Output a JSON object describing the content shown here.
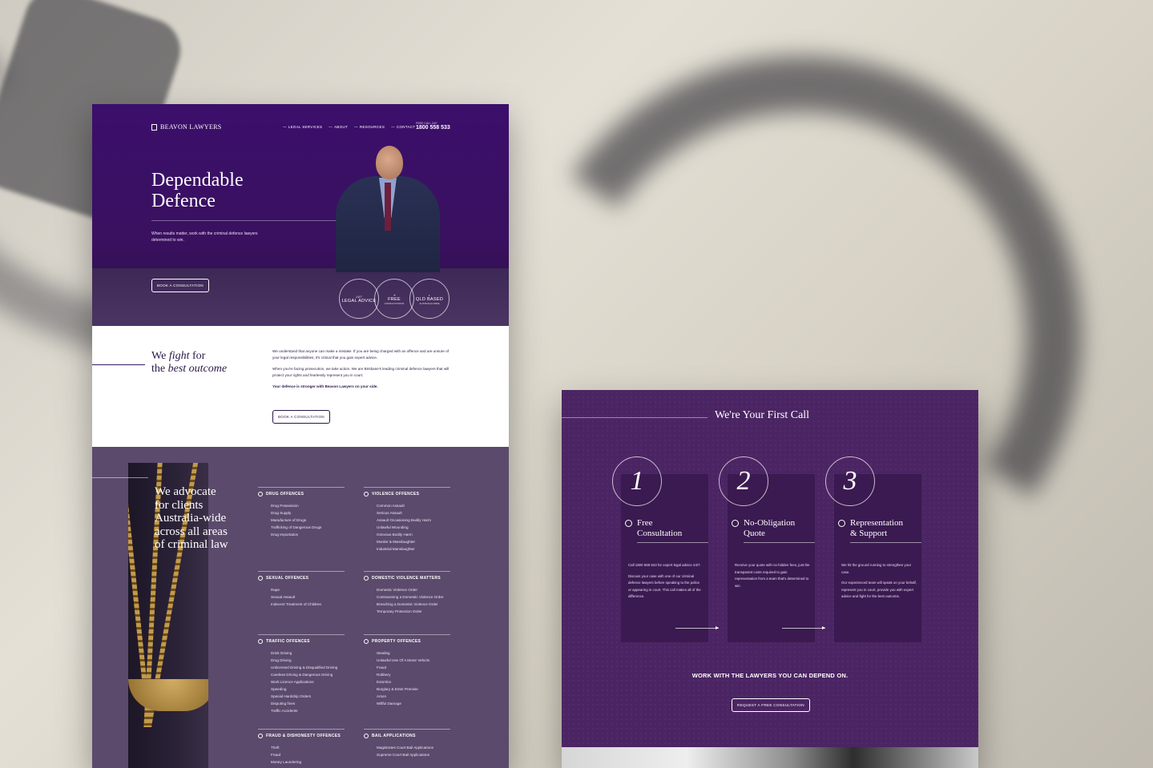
{
  "site": {
    "brand": "BEAVON LAWYERS",
    "nav": [
      "LEGAL SERVICES",
      "ABOUT",
      "RESOURCES",
      "CONTACT"
    ],
    "phone_label": "FREE CALL 24/7",
    "phone": "1800 558 533"
  },
  "hero": {
    "title_line1": "Dependable",
    "title_line2": "Defence",
    "subtitle": "When results matter, work with the criminal defence lawyers determined to win.",
    "cta": "BOOK A CONSULTATION",
    "badges": [
      {
        "top": "24/7",
        "main": "LEGAL ADVICE",
        "sub": ""
      },
      {
        "top": "",
        "main": "FREE",
        "sub": "CONSULTATIONS"
      },
      {
        "top": "",
        "main": "QLD BASED",
        "sub": "AUSTRALIA WIDE"
      }
    ]
  },
  "intro": {
    "title_a": "We",
    "title_b": "fight",
    "title_c": "for",
    "title_d": "the",
    "title_e": "best outcome",
    "para1": "We understand that anyone can make a mistake. If you are being charged with an offence and are unsure of your legal responsibilities, it's critical that you gain expert advice.",
    "para2": "When you're facing prosecution, we take action. We are Brisbane's leading criminal defence lawyers that will protect your rights and fearlessly represent you in court.",
    "para3": "Your defence is stronger with Beavon Lawyers on your side.",
    "cta": "BOOK A CONSULTATION"
  },
  "practice": {
    "title_lines": [
      "We advocate",
      "for clients",
      "Australia-wide",
      "across all areas",
      "of criminal law"
    ],
    "categories": [
      {
        "name": "DRUG OFFENCES",
        "items": [
          "Drug Possession",
          "Drug Supply",
          "Manufacture of Drugs",
          "Trafficking of Dangerous Drugs",
          "Drug Importation"
        ]
      },
      {
        "name": "VIOLENCE OFFENCES",
        "items": [
          "Common Assault",
          "Serious Assault",
          "Assault Occasioning Bodily Harm",
          "Unlawful Wounding",
          "Grievous Bodily Harm",
          "Murder & Manslaughter",
          "Industrial Manslaughter"
        ]
      },
      {
        "name": "SEXUAL OFFENCES",
        "items": [
          "Rape",
          "Sexual Assault",
          "Indecent Treatment of Children"
        ]
      },
      {
        "name": "DOMESTIC VIOLENCE MATTERS",
        "items": [
          "Domestic Violence Order",
          "Contravening a Domestic Violence Order",
          "Breaching a Domestic Violence Order",
          "Temporary Protection Order"
        ]
      },
      {
        "name": "TRAFFIC OFFENCES",
        "items": [
          "Drink Driving",
          "Drug Driving",
          "Unlicensed Driving & Disqualified Driving",
          "Careless Driving & Dangerous Driving",
          "Work Licence Applications",
          "Speeding",
          "Special Hardship Orders",
          "Disputing fines",
          "Traffic Accidents"
        ]
      },
      {
        "name": "PROPERTY OFFENCES",
        "items": [
          "Stealing",
          "Unlawful Use Of A Motor Vehicle",
          "Fraud",
          "Robbery",
          "Extortion",
          "Burglary & Enter Premise",
          "Arson",
          "Willful Damage"
        ]
      },
      {
        "name": "FRAUD & DISHONESTY OFFENCES",
        "items": [
          "Theft",
          "Fraud",
          "Money Laundering"
        ]
      },
      {
        "name": "BAIL APPLICATIONS",
        "items": [
          "Magistrates Court Bail Applications",
          "Supreme Court Bail Applications"
        ]
      }
    ]
  },
  "first_call": {
    "title": "We're Your First Call",
    "steps": [
      {
        "num": "1",
        "title_l1": "Free",
        "title_l2": "Consultation",
        "p1": "Call 1800 558 533 for expert legal advice 24/7.",
        "p2": "Discuss your case with one of our criminal defence lawyers before speaking to the police or appearing in court. This call makes all of the difference."
      },
      {
        "num": "2",
        "title_l1": "No-Obligation",
        "title_l2": "Quote",
        "p1": "Receive your quote with no hidden fees, just the transparent costs required to gain representation from a team that's determined to win.",
        "p2": ""
      },
      {
        "num": "3",
        "title_l1": "Representation",
        "title_l2": "& Support",
        "p1": "We hit the ground running to strengthen your case.",
        "p2": "Our experienced team will speak on your behalf, represent you in court, provide you with expert advice and fight for the best outcome."
      }
    ],
    "cta_text": "WORK WITH THE LAWYERS YOU CAN DEPEND ON.",
    "cta_button": "REQUEST A FREE CONSULTATION"
  },
  "colors": {
    "brand_purple": "#3b0f6b",
    "panel_purple": "#4b2563",
    "muted_purple": "#5b4a6c"
  }
}
